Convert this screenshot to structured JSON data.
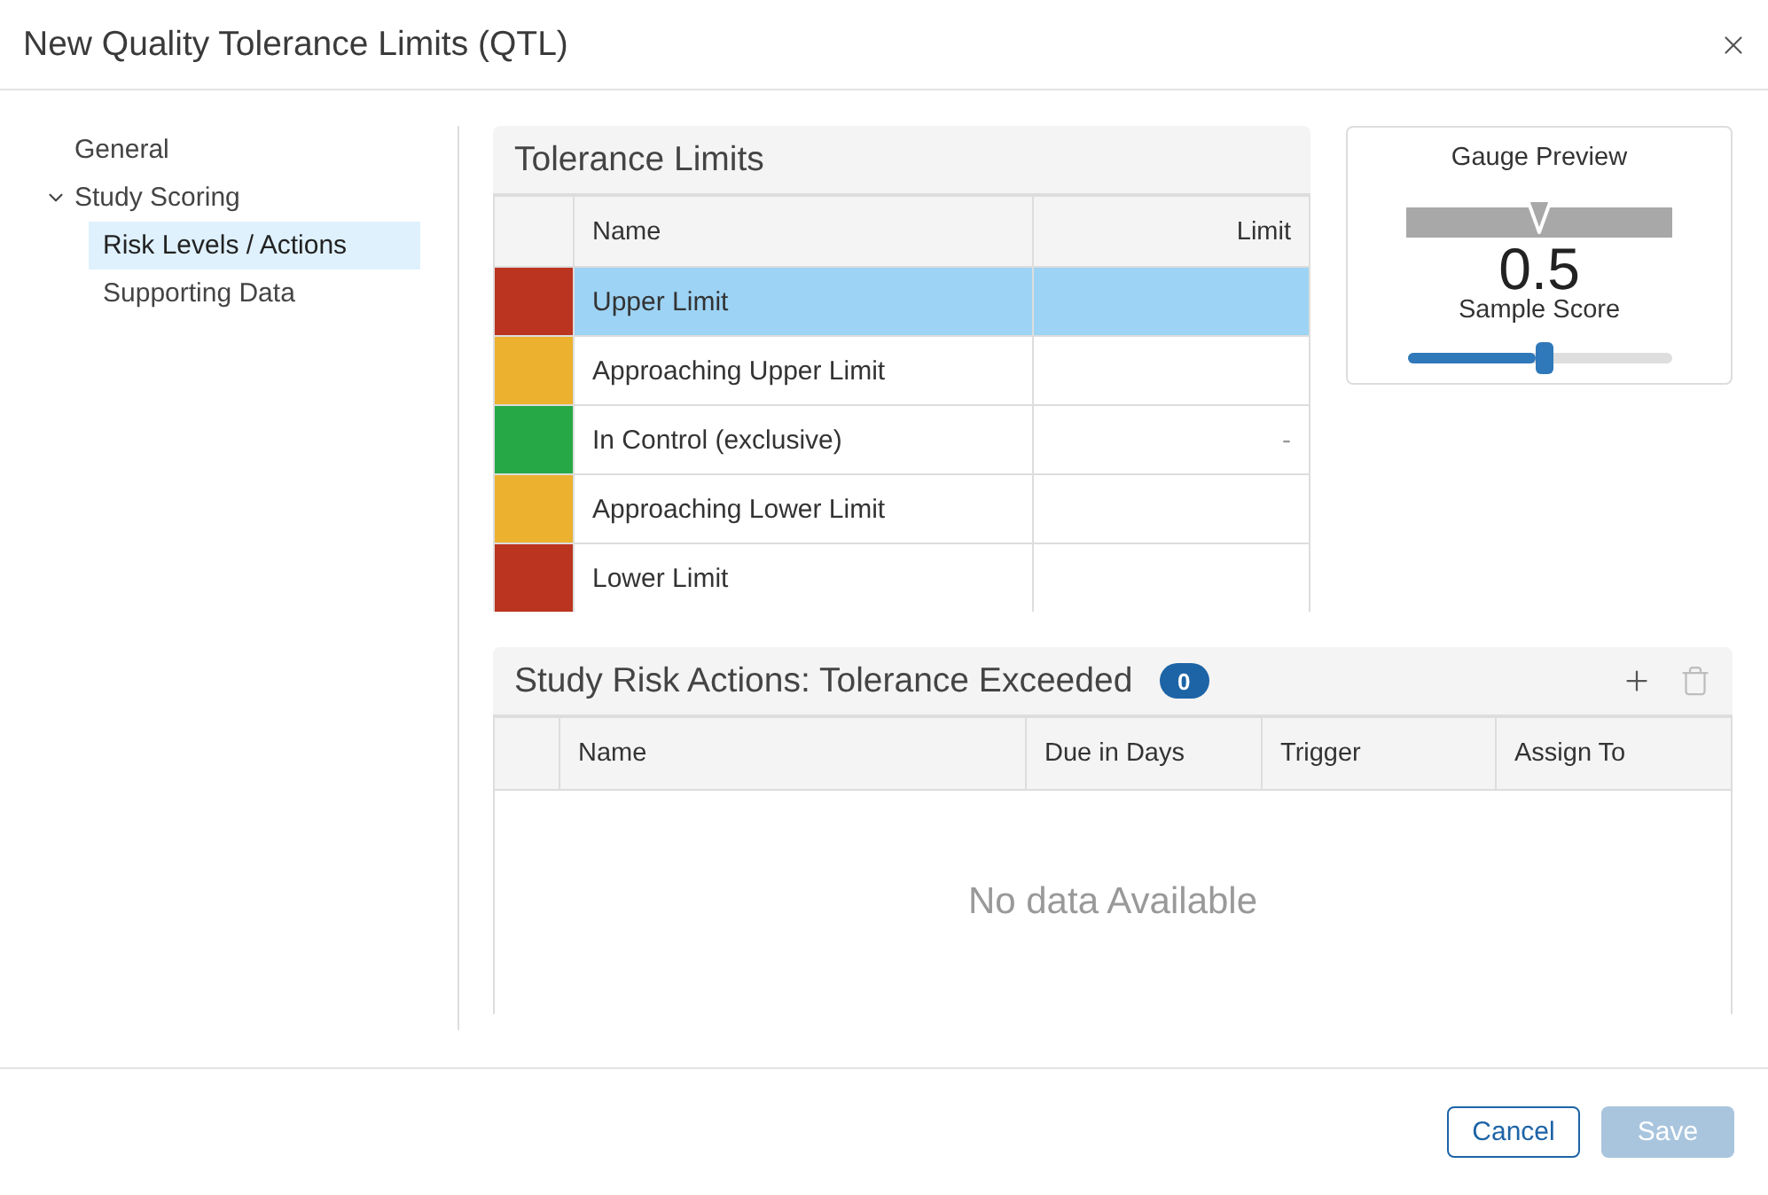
{
  "dialog": {
    "title": "New Quality Tolerance Limits (QTL)"
  },
  "sidebar": {
    "items": [
      {
        "label": "General",
        "selected": false
      },
      {
        "label": "Study Scoring",
        "selected": false,
        "expanded": true,
        "children": [
          {
            "label": "Risk Levels / Actions",
            "selected": true
          },
          {
            "label": "Supporting Data",
            "selected": false
          }
        ]
      }
    ]
  },
  "tolerance_limits": {
    "title": "Tolerance Limits",
    "columns": [
      "Name",
      "Limit"
    ],
    "rows": [
      {
        "name": "Upper Limit",
        "color": "#bb3420",
        "selected": true
      },
      {
        "name": "Approaching Upper Limit",
        "color": "#ebb12f",
        "selected": false
      },
      {
        "name": "In Control (exclusive)",
        "color": "#27a847",
        "limit": "-",
        "selected": false
      },
      {
        "name": "Approaching Lower Limit",
        "color": "#ebb12f",
        "selected": false
      },
      {
        "name": "Lower Limit",
        "color": "#bb3420",
        "selected": false
      }
    ]
  },
  "gauge_preview": {
    "title": "Gauge Preview",
    "value": "0.5",
    "caption": "Sample Score",
    "level": 0.5
  },
  "risk_actions": {
    "title": "Study Risk Actions: Tolerance Exceeded",
    "count": "0",
    "toolbar": [
      {
        "kind": "add",
        "disabled": false
      },
      {
        "kind": "delete",
        "disabled": true
      }
    ],
    "columns": [
      "Name",
      "Due in Days",
      "Trigger",
      "Assign To"
    ],
    "empty_text": "No data Available"
  },
  "footer": {
    "buttons": [
      {
        "label": "Cancel",
        "kind": "secondary",
        "disabled": false
      },
      {
        "label": "Save",
        "kind": "primary",
        "disabled": true
      }
    ]
  }
}
